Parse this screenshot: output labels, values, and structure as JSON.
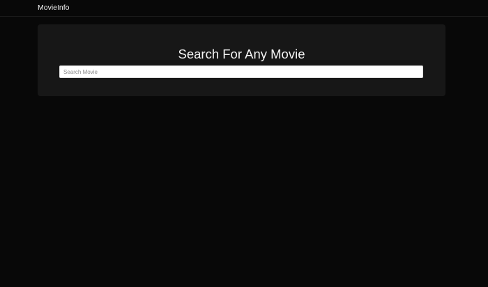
{
  "navbar": {
    "brand": "MovieInfo"
  },
  "hero": {
    "title": "Search For Any Movie",
    "search": {
      "placeholder": "Search Movie",
      "value": ""
    }
  }
}
